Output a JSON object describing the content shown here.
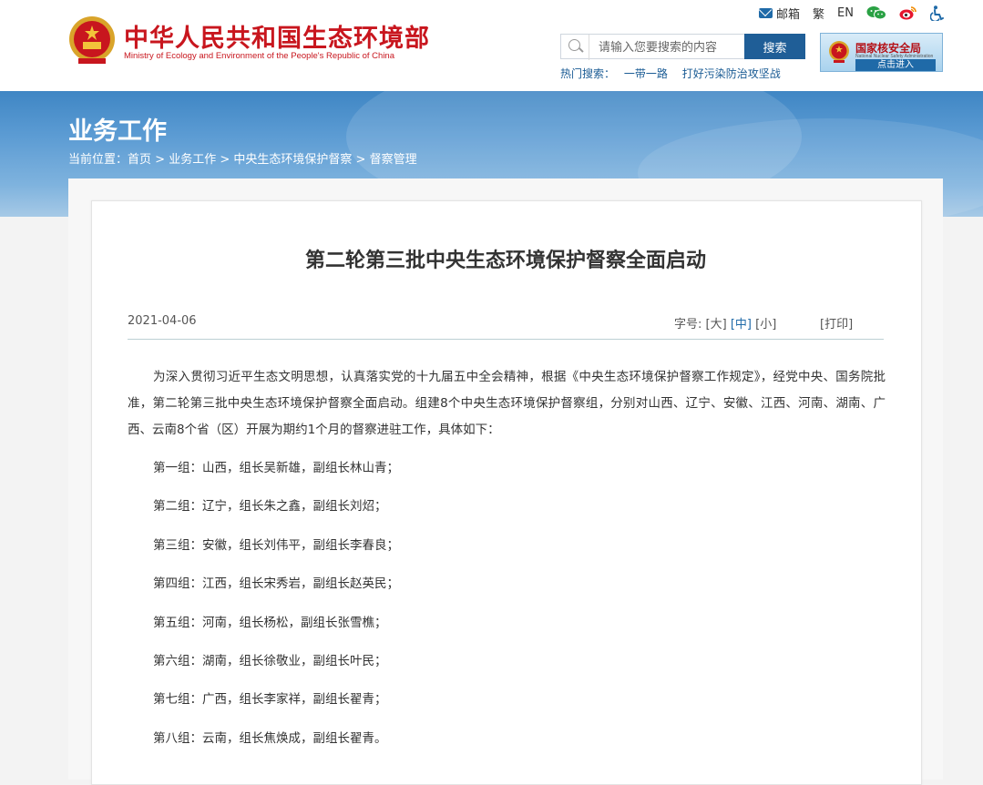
{
  "header": {
    "logo_cn": "中华人民共和国生态环境部",
    "logo_en": "Ministry of Ecology and Environment of the People's Republic of China",
    "links": {
      "mail": "邮箱",
      "traditional": "繁",
      "english": "EN"
    },
    "search": {
      "placeholder": "请输入您要搜索的内容",
      "button": "搜索"
    },
    "hot_search": {
      "label": "热门搜索：",
      "keywords": [
        "一带一路",
        "打好污染防治攻坚战"
      ]
    },
    "nsa": {
      "title": "国家核安全局",
      "subtitle": "National Nuclear Safety Administration",
      "enter": "点击进入"
    }
  },
  "banner": {
    "heading": "业务工作",
    "breadcrumb": {
      "prefix": "当前位置：",
      "items": [
        "首页",
        "业务工作",
        "中央生态环境保护督察",
        "督察管理"
      ],
      "sep": " > "
    }
  },
  "article": {
    "title": "第二轮第三批中央生态环境保护督察全面启动",
    "date": "2021-04-06",
    "font_size": {
      "label": "字号:",
      "large": "[大]",
      "medium": "[中]",
      "small": "[小]"
    },
    "print": "[打印]",
    "intro": "为深入贯彻习近平生态文明思想，认真落实党的十九届五中全会精神，根据《中央生态环境保护督察工作规定》，经党中央、国务院批准，第二轮第三批中央生态环境保护督察全面启动。组建8个中央生态环境保护督察组，分别对山西、辽宁、安徽、江西、河南、湖南、广西、云南8个省（区）开展为期约1个月的督察进驻工作，具体如下：",
    "groups": [
      "第一组：山西，组长吴新雄，副组长林山青；",
      "第二组：辽宁，组长朱之鑫，副组长刘炤；",
      "第三组：安徽，组长刘伟平，副组长李春良；",
      "第四组：江西，组长宋秀岩，副组长赵英民；",
      "第五组：河南，组长杨松，副组长张雪樵；",
      "第六组：湖南，组长徐敬业，副组长叶民；",
      "第七组：广西，组长李家祥，副组长翟青；",
      "第八组：云南，组长焦焕成，副组长翟青。"
    ]
  },
  "colors": {
    "brand_red": "#c8161e",
    "link_blue": "#1a5b94",
    "button_blue": "#1f5e97"
  }
}
